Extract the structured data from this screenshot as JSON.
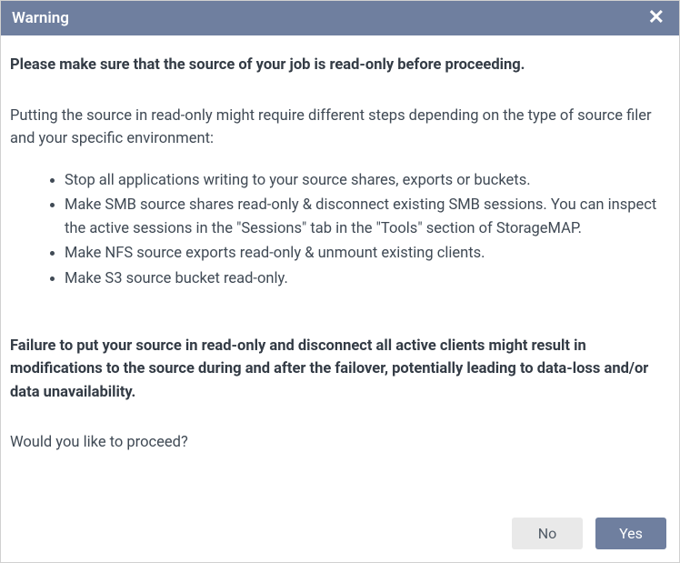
{
  "dialog": {
    "title": "Warning",
    "close_label": "✕"
  },
  "body": {
    "heading": "Please make sure that the source of your job is read-only before proceeding.",
    "intro": "Putting the source in read-only might require different steps depending on the type of source filer and your specific environment:",
    "steps": [
      "Stop all applications writing to your source shares, exports or buckets.",
      "Make SMB source shares read-only & disconnect existing SMB sessions. You can inspect the active sessions in the \"Sessions\" tab in the \"Tools\" section of StorageMAP.",
      "Make NFS source exports read-only & unmount existing clients.",
      "Make S3 source bucket read-only."
    ],
    "warning_note": "Failure to put your source in read-only and disconnect all active clients might result in modifications to the source during and after the failover, potentially leading to data-loss and/or data unavailability.",
    "prompt": "Would you like to proceed?"
  },
  "footer": {
    "no_label": "No",
    "yes_label": "Yes"
  }
}
